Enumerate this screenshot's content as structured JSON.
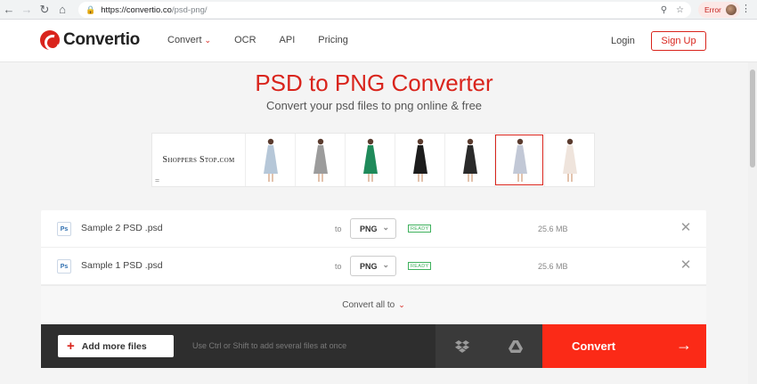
{
  "browser": {
    "url_host": "https://convertio.co",
    "url_path": "/psd-png/",
    "error_label": "Error"
  },
  "header": {
    "logo_text": "Convertio",
    "nav": [
      "Convert",
      "OCR",
      "API",
      "Pricing"
    ],
    "login": "Login",
    "signup": "Sign Up"
  },
  "hero": {
    "title": "PSD to PNG Converter",
    "subtitle": "Convert your psd files to png online & free"
  },
  "ad": {
    "brand": "Shoppers Stop.com",
    "mark": "=",
    "dress_colors": [
      "#b6c7d8",
      "#9c9c9c",
      "#1f8a5a",
      "#1c1c1c",
      "#2a2a2a",
      "#c2c8d6",
      "#efe4dc"
    ]
  },
  "files": [
    {
      "icon": "Ps",
      "name": "Sample 2 PSD .psd",
      "to": "to",
      "format": "PNG",
      "status": "READY",
      "size": "25.6 MB"
    },
    {
      "icon": "Ps",
      "name": "Sample 1 PSD .psd",
      "to": "to",
      "format": "PNG",
      "status": "READY",
      "size": "25.6 MB"
    }
  ],
  "convert_all": "Convert all to",
  "actions": {
    "add_more": "Add more files",
    "hint": "Use Ctrl or Shift to add several files at once",
    "convert": "Convert"
  },
  "colors": {
    "accent": "#d9241c",
    "convert_button": "#fb2a17",
    "ready": "#3fb15d"
  }
}
